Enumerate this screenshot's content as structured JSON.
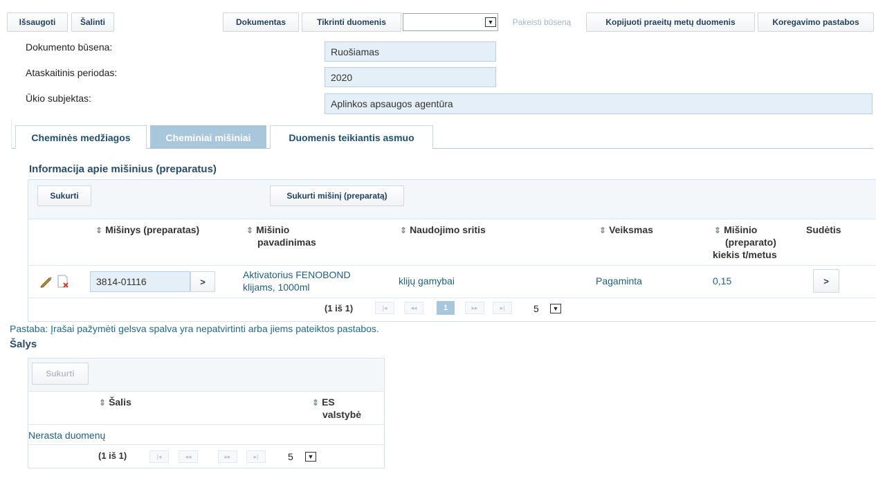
{
  "toolbar": {
    "save": "Išsaugoti",
    "delete": "Šalinti",
    "document": "Dokumentas",
    "check_data": "Tikrinti duomenis",
    "change_status": "Pakeisti būseną",
    "copy_prev": "Kopijuoti praeitų metų duomenis",
    "correction_notes": "Koregavimo pastabos"
  },
  "form": {
    "status_label": "Dokumento būsena:",
    "status_value": "Ruošiamas",
    "period_label": "Ataskaitinis periodas:",
    "period_value": "2020",
    "entity_label": "Ūkio subjektas:",
    "entity_value": "Aplinkos apsaugos agentūra"
  },
  "tabs": [
    "Cheminės medžiagos",
    "Cheminiai mišiniai",
    "Duomenis teikiantis asmuo"
  ],
  "mixtures": {
    "title": "Informacija apie mišinius (preparatus)",
    "create": "Sukurti",
    "create_mixture": "Sukurti mišinį (preparatą)",
    "headers": {
      "mixture": "Mišinys (preparatas)",
      "name_1": "Mišinio",
      "name_2": "pavadinimas",
      "usage": "Naudojimo sritis",
      "action": "Veiksmas",
      "qty_1": "Mišinio",
      "qty_2": "(preparato)",
      "qty_3": "kiekis t/metus",
      "composition": "Sudėtis"
    },
    "row": {
      "code": "3814-01116",
      "go": ">",
      "name_1": "Aktivatorius FENOBOND",
      "name_2": "klijams, 1000ml",
      "usage": "klijų gamybai",
      "action": "Pagaminta",
      "qty": "0,15",
      "comp_go": ">"
    },
    "pager": {
      "info": "(1 iš 1)",
      "first": "|◂",
      "prev": "◂◂",
      "page": "1",
      "next": "▸▸",
      "last": "▸|",
      "size": "5"
    }
  },
  "note": "Pastaba: Įrašai pažymėti gelsva spalva yra nepatvirtinti arba jiems pateiktos pastabos.",
  "countries": {
    "title": "Šalys",
    "create": "Sukurti",
    "h_country": "Šalis",
    "h_es_1": "ES",
    "h_es_2": "valstybė",
    "empty": "Nerasta duomenų",
    "pager": {
      "info": "(1 iš 1)",
      "first": "|◂",
      "prev": "◂◂",
      "next": "▸▸",
      "last": "▸|",
      "size": "5"
    }
  },
  "icons": {
    "sort": "⇕",
    "dropdown": "▼"
  }
}
